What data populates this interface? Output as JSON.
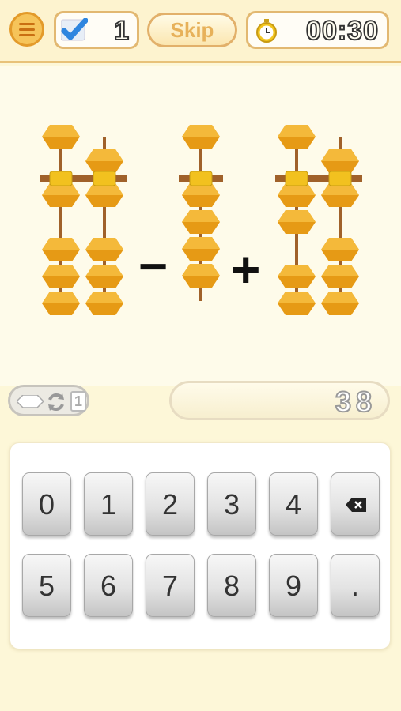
{
  "header": {
    "menu_icon": "hamburger-menu-icon",
    "score": {
      "icon": "checkmark-icon",
      "value": "1"
    },
    "skip_label": "Skip",
    "timer": {
      "icon": "stopwatch-icon",
      "value": "00:30"
    }
  },
  "problem": {
    "terms": [
      {
        "operator": "",
        "value": 16,
        "visual": "abacus-2-rods"
      },
      {
        "operator": "−",
        "value": 4,
        "visual": "abacus-1-rod"
      },
      {
        "operator": "+",
        "value": 26,
        "visual": "abacus-2-rods"
      }
    ]
  },
  "mode_badge": {
    "icons": [
      "bead-icon",
      "cycle-arrows-icon"
    ],
    "count": "1"
  },
  "answer": {
    "value": "38"
  },
  "keypad": {
    "rows": [
      [
        "0",
        "1",
        "2",
        "3",
        "4",
        "⌫"
      ],
      [
        "5",
        "6",
        "7",
        "8",
        "9",
        "."
      ]
    ]
  },
  "colors": {
    "bead": "#e69a15",
    "rod": "#a0612a",
    "background": "#fdf7d8",
    "header_border": "#e8c27a"
  }
}
